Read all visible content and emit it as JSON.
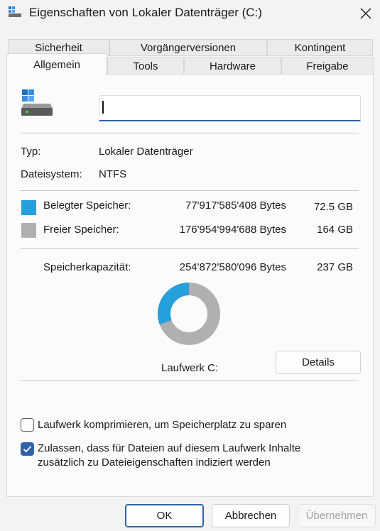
{
  "window": {
    "title": "Eigenschaften von Lokaler Datenträger (C:)"
  },
  "tabs": {
    "row1": [
      "Sicherheit",
      "Vorgängerversionen",
      "Kontingent"
    ],
    "row2": [
      "Allgemein",
      "Tools",
      "Hardware",
      "Freigabe"
    ],
    "active": "Allgemein"
  },
  "general": {
    "drive_name_value": "",
    "type_label": "Typ:",
    "type_value": "Lokaler Datenträger",
    "fs_label": "Dateisystem:",
    "fs_value": "NTFS",
    "used_label": "Belegter Speicher:",
    "used_bytes": "77'917'585'408 Bytes",
    "used_size": "72.5 GB",
    "free_label": "Freier Speicher:",
    "free_bytes": "176'954'994'688 Bytes",
    "free_size": "164 GB",
    "capacity_label": "Speicherkapazität:",
    "capacity_bytes": "254'872'580'096 Bytes",
    "capacity_size": "237 GB",
    "drive_caption": "Laufwerk C:",
    "details_button": "Details",
    "used_fraction": 0.306,
    "colors": {
      "used": "#26a0da",
      "free": "#b0b0b0"
    }
  },
  "options": {
    "compress_label": "Laufwerk komprimieren, um Speicherplatz zu sparen",
    "compress_checked": false,
    "index_label_line1": "Zulassen, dass für Dateien auf diesem Laufwerk Inhalte",
    "index_label_line2": "zusätzlich zu Dateieigenschaften indiziert werden",
    "index_checked": true
  },
  "buttons": {
    "ok": "OK",
    "cancel": "Abbrechen",
    "apply": "Übernehmen"
  }
}
